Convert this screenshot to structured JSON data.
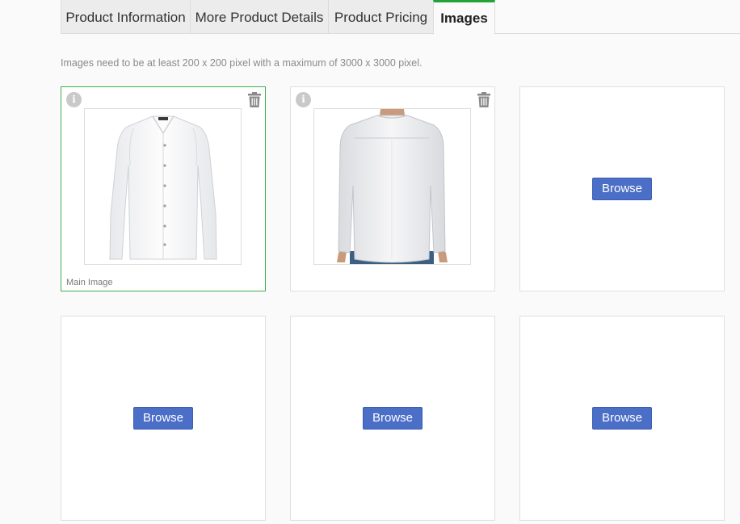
{
  "tabs": [
    {
      "label": "Product Information",
      "active": false
    },
    {
      "label": "More Product Details",
      "active": false
    },
    {
      "label": "Product Pricing",
      "active": false
    },
    {
      "label": "Images",
      "active": true
    }
  ],
  "hint": "Images need to be at least 200 x 200 pixel with a maximum of 3000 x 3000 pixel.",
  "slots": [
    {
      "caption": "Main Image",
      "info_icon": "i"
    },
    {
      "info_icon": "i"
    },
    {
      "browse_label": "Browse"
    },
    {
      "browse_label": "Browse"
    },
    {
      "browse_label": "Browse"
    },
    {
      "browse_label": "Browse"
    }
  ],
  "colors": {
    "active_tab_accent": "#22a33a",
    "main_image_border": "#3fae52",
    "browse_button": "#4b6fc7"
  }
}
